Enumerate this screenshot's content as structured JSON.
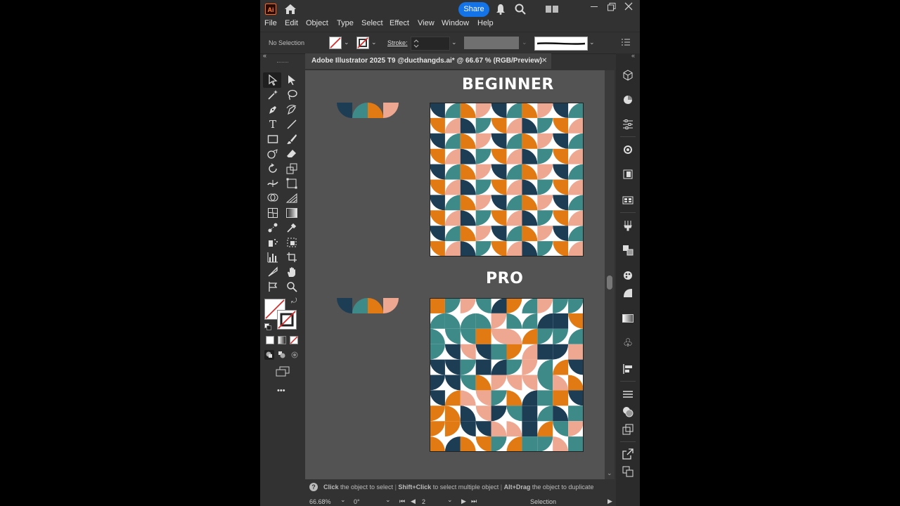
{
  "app": {
    "logo": "Ai",
    "share_label": "Share"
  },
  "menu": [
    "File",
    "Edit",
    "Object",
    "Type",
    "Select",
    "Effect",
    "View",
    "Window",
    "Help"
  ],
  "control_bar": {
    "selection_status": "No Selection",
    "stroke_label": "Stroke:"
  },
  "document": {
    "tab_title": "Adobe Illustrator 2025 T9 @ducthangds.ai* @ 66.67 % (RGB/Preview)",
    "close_symbol": "✕",
    "heading_top": "BEGINNER",
    "heading_bottom": "PRO"
  },
  "palette": {
    "navy": "#1d3d55",
    "teal": "#3d8a89",
    "orange": "#e27a13",
    "peach": "#eea892",
    "white": "#ffffff"
  },
  "status_hint": {
    "part1_bold": "Click",
    "part1": " the object to select",
    "part2_bold": "Shift+Click",
    "part2": " to select multiple object",
    "part3_bold": "Alt+Drag",
    "part3": " the object to duplicate"
  },
  "bottom_bar": {
    "zoom": "66.68%",
    "rotation": "0°",
    "artboard": "2",
    "tool_name": "Selection"
  },
  "tools_more": "•••"
}
